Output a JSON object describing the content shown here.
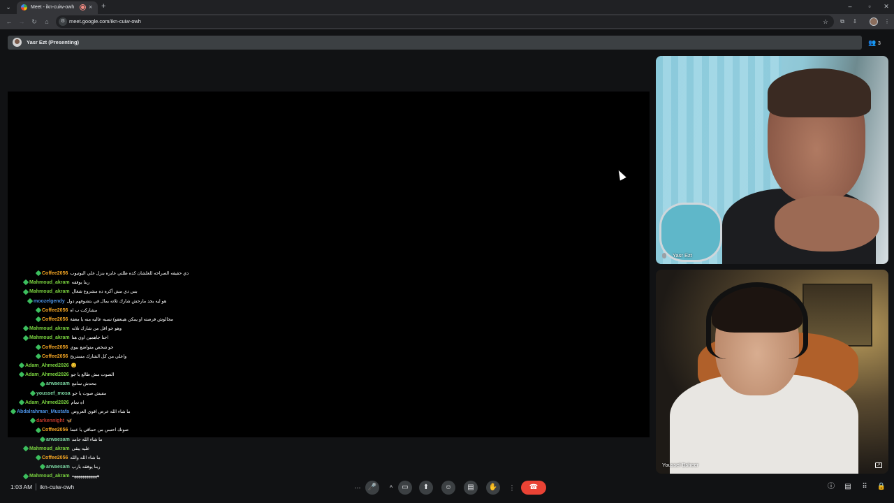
{
  "browser": {
    "tab_title": "Meet - ikn-cuiw-owh",
    "tab_close": "×",
    "new_tab": "+",
    "url": "meet.google.com/ikn-cuiw-owh"
  },
  "meet": {
    "presenter_label": "Yasr Ezt (Presenting)",
    "participant_count": "3",
    "time": "1:03 AM",
    "meeting_code": "ikn-cuiw-owh"
  },
  "tiles": [
    {
      "name": "Yasr Ezt"
    },
    {
      "name": "Youssef Bsheer"
    }
  ],
  "chat": [
    {
      "user": "Coffee2056",
      "color": "#f5a623",
      "indent": 52,
      "msg": "دي حقيقه الصراحه للعلشان كده ظلتي عايزه بنزل علي اليوتيوب"
    },
    {
      "user": "Mahmoud_akram",
      "color": "#7ad33f",
      "indent": 34,
      "msg": "ربنا يوفقه"
    },
    {
      "user": "Mahmoud_akram",
      "color": "#7ad33f",
      "indent": 34,
      "msg": "بس دي مش أكره ده مشروع شغال"
    },
    {
      "user": "moozelgendy",
      "color": "#4a90e2",
      "indent": 40,
      "msg": "هو ليه بجد مارحش شارك تلاته يمال في بتشوفهم دول"
    },
    {
      "user": "Coffee2056",
      "color": "#f5a623",
      "indent": 52,
      "msg": "مشاركت ب اه"
    },
    {
      "user": "Coffee2056",
      "color": "#f5a623",
      "indent": 52,
      "msg": "مجالوش فرصته او يمكن هينعفو) نسبه عاليه منه يا معفة"
    },
    {
      "user": "Mahmoud_akram",
      "color": "#7ad33f",
      "indent": 34,
      "msg": "وهو جو اقل من شارك تلاته"
    },
    {
      "user": "Mahmoud_akram",
      "color": "#7ad33f",
      "indent": 34,
      "msg": "احنا جاهمين اوي هنا"
    },
    {
      "user": "Coffee2056",
      "color": "#f5a623",
      "indent": 52,
      "msg": "جو شخص متواضع بيوي"
    },
    {
      "user": "Coffee2056",
      "color": "#f5a623",
      "indent": 52,
      "msg": "واعلي من كل الشارك مستريح"
    },
    {
      "user": "Adam_Ahmed2026",
      "color": "#7ad33f",
      "indent": 28,
      "msg": "😊"
    },
    {
      "user": "Adam_Ahmed2026",
      "color": "#7ad33f",
      "indent": 28,
      "msg": "الصوت مش طالع يا جو"
    },
    {
      "user": "arwaesam",
      "color": "#7ad3a0",
      "indent": 58,
      "msg": "محدش سامع"
    },
    {
      "user": "youssef_mosa",
      "color": "#7ad3a0",
      "indent": 44,
      "msg": "مفيش صوت يا جو"
    },
    {
      "user": "Adam_Ahmed2026",
      "color": "#7ad33f",
      "indent": 28,
      "msg": "اه تمام"
    },
    {
      "user": "Abdalrahman_Mustafa",
      "color": "#4a90e2",
      "indent": 16,
      "msg": "ما شاء الله عرض اقوي العروض"
    },
    {
      "user": "darkennight",
      "color": "#c0392b",
      "indent": 44,
      "msg": "🦋"
    },
    {
      "user": "Coffee2056",
      "color": "#f5a623",
      "indent": 52,
      "msg": "صوتك احسن من حماقي يا عمنا"
    },
    {
      "user": "arwaesam",
      "color": "#7ad3a0",
      "indent": 58,
      "msg": "ما شاء الله جامد"
    },
    {
      "user": "Mahmoud_akram",
      "color": "#7ad33f",
      "indent": 34,
      "msg": "عليه يبقى"
    },
    {
      "user": "Coffee2056",
      "color": "#f5a623",
      "indent": 52,
      "msg": "ما شاء الله والله"
    },
    {
      "user": "arwaesam",
      "color": "#7ad3a0",
      "indent": 58,
      "msg": "ربنا يوفقه بارب"
    },
    {
      "user": "Mahmoud_akram",
      "color": "#7ad33f",
      "indent": 34,
      "msg": "ههههههههههههه"
    }
  ],
  "controls": {
    "more_options": "⋯",
    "mic": "🎤",
    "mic_arrow": "^",
    "camera": "▭",
    "present": "⬆",
    "emoji": "☺",
    "captions": "▤",
    "raise_hand": "✋",
    "more": "⋮",
    "hangup": "☎"
  }
}
